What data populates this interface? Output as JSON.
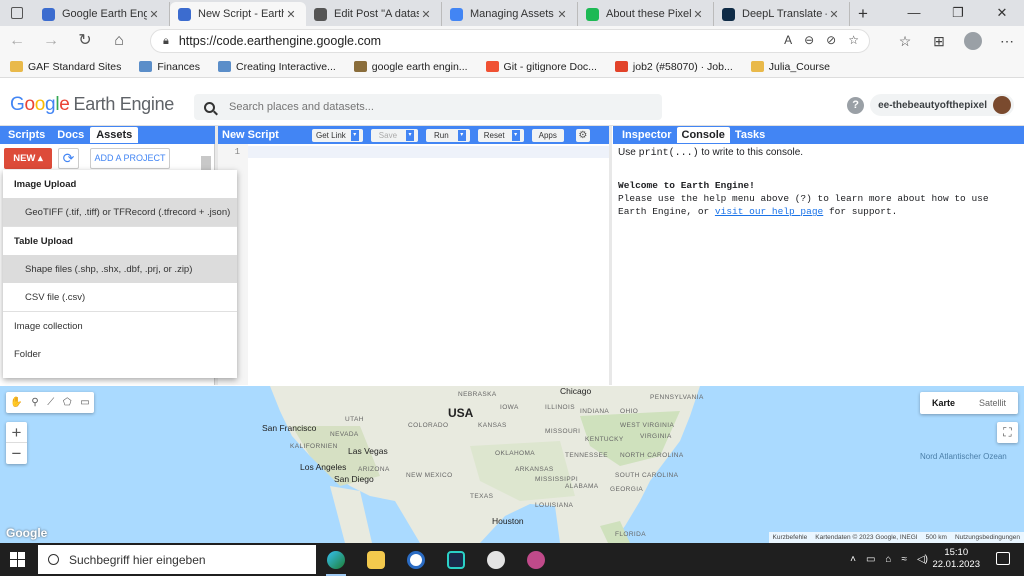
{
  "browser": {
    "tabs": [
      {
        "title": "Google Earth Engine",
        "favicon_color": "#3c6ccf"
      },
      {
        "title": "New Script - Earth Engine",
        "favicon_color": "#3c6ccf",
        "active": true
      },
      {
        "title": "Edit Post \"A dataset\"",
        "favicon_color": "#555555"
      },
      {
        "title": "Managing Assets | Google",
        "favicon_color": "#4285f4"
      },
      {
        "title": "About these Pixels",
        "favicon_color": "#1db954"
      },
      {
        "title": "DeepL Translate – Der",
        "favicon_color": "#0f2b46"
      }
    ],
    "url": "https://code.earthengine.google.com",
    "bookmarks": [
      {
        "label": "GAF Standard Sites",
        "icon": "folder-icon"
      },
      {
        "label": "Finances",
        "icon": "chart-icon"
      },
      {
        "label": "Creating Interactive...",
        "icon": "chart-icon"
      },
      {
        "label": "google earth engin...",
        "icon": "site-icon"
      },
      {
        "label": "Git - gitignore Doc...",
        "icon": "git-icon"
      },
      {
        "label": "job2 (#58070) · Job...",
        "icon": "gitlab-icon"
      },
      {
        "label": "Julia_Course",
        "icon": "folder-icon"
      }
    ]
  },
  "header": {
    "logo_google": "Google",
    "logo_product": "Earth Engine",
    "search_placeholder": "Search places and datasets...",
    "help_icon": "?",
    "user": "ee-thebeautyofthepixel"
  },
  "left_panel": {
    "tabs": [
      "Scripts",
      "Docs",
      "Assets"
    ],
    "active_tab": "Assets",
    "new_button": "NEW",
    "add_project_button": "ADD A PROJECT",
    "menu": [
      {
        "label": "Image Upload",
        "kind": "head"
      },
      {
        "label": "GeoTIFF (.tif, .tiff) or TFRecord (.tfrecord + .json)",
        "kind": "sub",
        "highlight": true
      },
      {
        "label": "Table Upload",
        "kind": "head"
      },
      {
        "label": "Shape files (.shp, .shx, .dbf, .prj, or .zip)",
        "kind": "sub",
        "highlight": true
      },
      {
        "label": "CSV file (.csv)",
        "kind": "sub"
      },
      {
        "label": "Image collection",
        "kind": "item"
      },
      {
        "label": "Folder",
        "kind": "item"
      }
    ]
  },
  "editor": {
    "title": "New Script",
    "buttons": {
      "get_link": "Get Link",
      "save": "Save",
      "run": "Run",
      "reset": "Reset",
      "apps": "Apps"
    },
    "line_number": "1"
  },
  "console_panel": {
    "tabs": [
      "Inspector",
      "Console",
      "Tasks"
    ],
    "active_tab": "Console",
    "hint_prefix": "Use ",
    "hint_code": "print(...)",
    "hint_suffix": " to write to this console.",
    "welcome_title": "Welcome to Earth Engine!",
    "welcome_line1": "Please use the help menu above (?) to learn more about how to use",
    "welcome_line2_prefix": "Earth Engine, or ",
    "welcome_link": "visit our help page",
    "welcome_line2_suffix": " for support."
  },
  "map": {
    "map_type_options": [
      "Karte",
      "Satellit"
    ],
    "selected_map_type": "Karte",
    "zoom_in": "+",
    "zoom_out": "−",
    "country_label": "USA",
    "city_labels": [
      "San Francisco",
      "Las Vegas",
      "Los Angeles",
      "San Diego",
      "Houston",
      "Chicago"
    ],
    "state_labels": [
      "NEBRASKA",
      "UTAH",
      "COLORADO",
      "KANSAS",
      "MISSOURI",
      "ARIZONA",
      "NEW MEXICO",
      "OKLAHOMA",
      "TEXAS",
      "KALIFORNIEN",
      "NEVADA",
      "IOWA",
      "INDIANA",
      "OHIO",
      "PENNSYLVANIA",
      "WEST VIRGINIA",
      "VIRGINIA",
      "TENNESSEE",
      "NORTH CAROLINA",
      "SOUTH CAROLINA",
      "ARKANSAS",
      "MISSISSIPPI",
      "ALABAMA",
      "GEORGIA",
      "LOUISIANA",
      "FLORIDA",
      "ILLINOIS",
      "KENTUCKY"
    ],
    "ocean_label": "Nord Atlantischer Ozean",
    "google_logo": "Google",
    "attribution": [
      "Kurzbefehle",
      "Kartendaten © 2023 Google, INEGI",
      "500 km",
      "Nutzungsbedingungen"
    ]
  },
  "taskbar": {
    "search_placeholder": "Suchbegriff hier eingeben",
    "time": "15:10",
    "date": "22.01.2023"
  }
}
